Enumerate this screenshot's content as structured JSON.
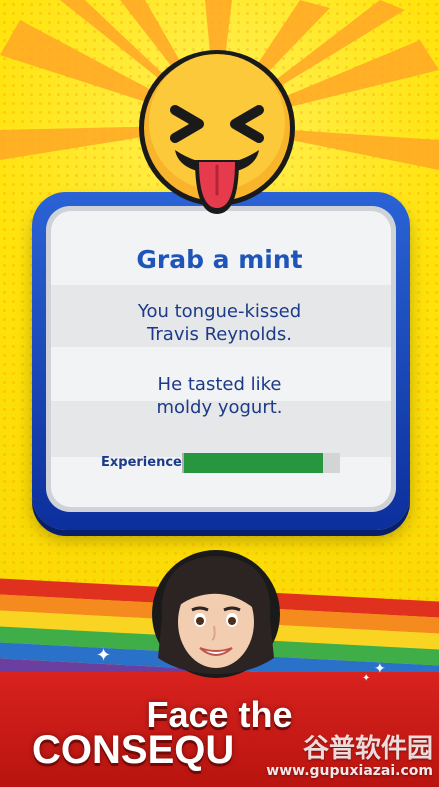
{
  "event": {
    "title": "Grab a mint",
    "message_1": "You tongue-kissed\nTravis Reynolds.",
    "message_2": "He tasted like\nmoldy yogurt.",
    "experience_label": "Experience",
    "experience_progress": 0.89
  },
  "promo": {
    "line1": "Face the",
    "line2": "CONSEQU"
  },
  "watermark": {
    "brand": "谷普软件园",
    "url": "www.gupuxiazai.com"
  },
  "colors": {
    "background_yellow": "#ffe30a",
    "card_frame_blue": "#1f55b8",
    "title_blue": "#1f55b8",
    "experience_green": "#27963e",
    "banner_red": "#d8221e"
  },
  "icons": {
    "emoji": "tongue-out-squinting-face-icon",
    "avatar": "woman-avatar-icon",
    "sparkle": "sparkle-icon"
  }
}
